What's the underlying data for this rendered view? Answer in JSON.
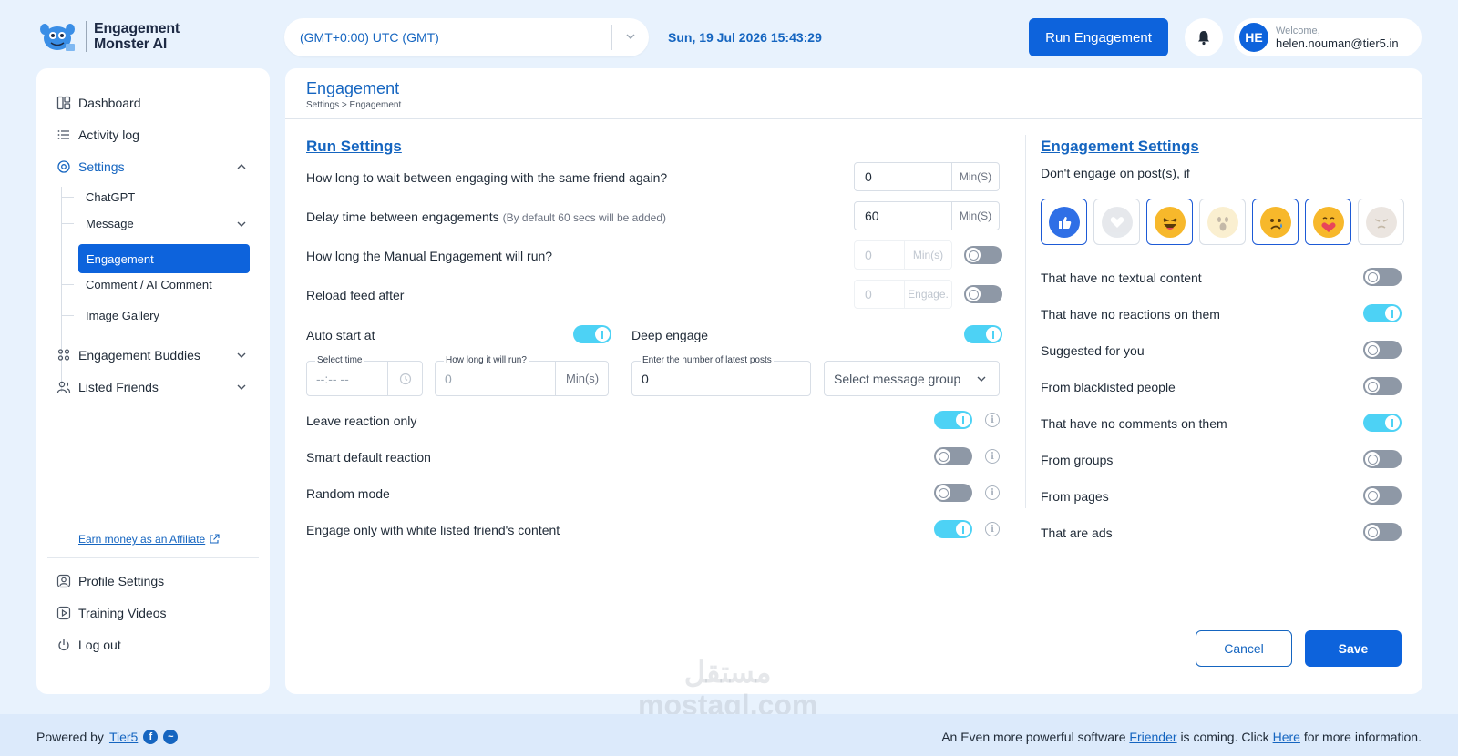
{
  "app": {
    "name_line1": "Engagement",
    "name_line2": "Monster AI"
  },
  "header": {
    "timezone": "(GMT+0:00) UTC (GMT)",
    "datetime": "Sun, 19 Jul 2026 15:43:29",
    "run_button": "Run Engagement",
    "user": {
      "initials": "HE",
      "welcome": "Welcome,",
      "email": "helen.nouman@tier5.in"
    }
  },
  "sidebar": {
    "items": [
      {
        "label": "Dashboard",
        "icon": "dashboard-icon"
      },
      {
        "label": "Activity log",
        "icon": "list-icon"
      },
      {
        "label": "Settings",
        "icon": "settings-icon"
      },
      {
        "label": "Engagement Buddies",
        "icon": "buddies-icon"
      },
      {
        "label": "Listed Friends",
        "icon": "friends-icon"
      }
    ],
    "sub_items": [
      "ChatGPT",
      "Message",
      "Engagement",
      "Comment / AI Comment",
      "Image Gallery"
    ],
    "affiliate": "Earn money as an Affiliate",
    "bottom": [
      {
        "label": "Profile Settings",
        "icon": "profile-icon"
      },
      {
        "label": "Training Videos",
        "icon": "video-icon"
      },
      {
        "label": "Log out",
        "icon": "power-icon"
      }
    ]
  },
  "page": {
    "title": "Engagement",
    "breadcrumb": "Settings > Engagement"
  },
  "run_settings": {
    "title": "Run Settings",
    "wait_label": "How long to wait between engaging with the same friend again?",
    "wait_value": "0",
    "wait_unit": "Min(S)",
    "delay_label": "Delay time between engagements",
    "delay_note": "(By default 60 secs will be added)",
    "delay_value": "60",
    "delay_unit": "Min(S)",
    "manual_label": "How long the Manual Engagement will run?",
    "manual_value": "0",
    "manual_unit": "Min(s)",
    "manual_enabled": false,
    "reload_label": "Reload feed after",
    "reload_value": "0",
    "reload_unit": "Engage.",
    "reload_enabled": false,
    "auto_start_label": "Auto start at",
    "auto_start_enabled": true,
    "select_time_label": "Select time",
    "select_time_placeholder": "--:-- --",
    "run_length_label": "How long it will run?",
    "run_length_value": "0",
    "run_length_unit": "Min(s)",
    "deep_engage_label": "Deep engage",
    "deep_engage_enabled": true,
    "latest_posts_label": "Enter the number of latest posts",
    "latest_posts_value": "0",
    "message_group_placeholder": "Select message group",
    "options": [
      {
        "label": "Leave reaction only",
        "enabled": true
      },
      {
        "label": "Smart default reaction",
        "enabled": false
      },
      {
        "label": "Random mode",
        "enabled": false
      },
      {
        "label": "Engage only with white listed friend's content",
        "enabled": true
      }
    ]
  },
  "engagement_settings": {
    "title": "Engagement Settings",
    "subtitle": "Don't engage on post(s), if",
    "reactions": [
      {
        "name": "like",
        "selected": true
      },
      {
        "name": "love",
        "selected": false
      },
      {
        "name": "haha",
        "selected": true
      },
      {
        "name": "wow",
        "selected": false
      },
      {
        "name": "sad",
        "selected": true
      },
      {
        "name": "care",
        "selected": true
      },
      {
        "name": "angry",
        "selected": false
      }
    ],
    "options": [
      {
        "label": "That have no textual content",
        "enabled": false
      },
      {
        "label": "That have no reactions on them",
        "enabled": true
      },
      {
        "label": "Suggested for you",
        "enabled": false
      },
      {
        "label": "From blacklisted people",
        "enabled": false
      },
      {
        "label": "That have no comments on them",
        "enabled": true
      },
      {
        "label": "From groups",
        "enabled": false
      },
      {
        "label": "From pages",
        "enabled": false
      },
      {
        "label": "That are ads",
        "enabled": false
      }
    ]
  },
  "actions": {
    "cancel": "Cancel",
    "save": "Save"
  },
  "footer": {
    "powered_by": "Powered by",
    "tier5": "Tier5",
    "notice_pre": "An Even more powerful software",
    "friender": "Friender",
    "notice_mid": "is coming. Click",
    "here": "Here",
    "notice_post": "for more information."
  },
  "watermark": {
    "arabic": "مستقل",
    "latin": "mostaql.com"
  },
  "colors": {
    "accent": "#0d63dc",
    "link": "#1565c0",
    "toggle_on": "#4dd2f5",
    "toggle_off": "#8e98a6",
    "background": "#e8f2fd"
  }
}
